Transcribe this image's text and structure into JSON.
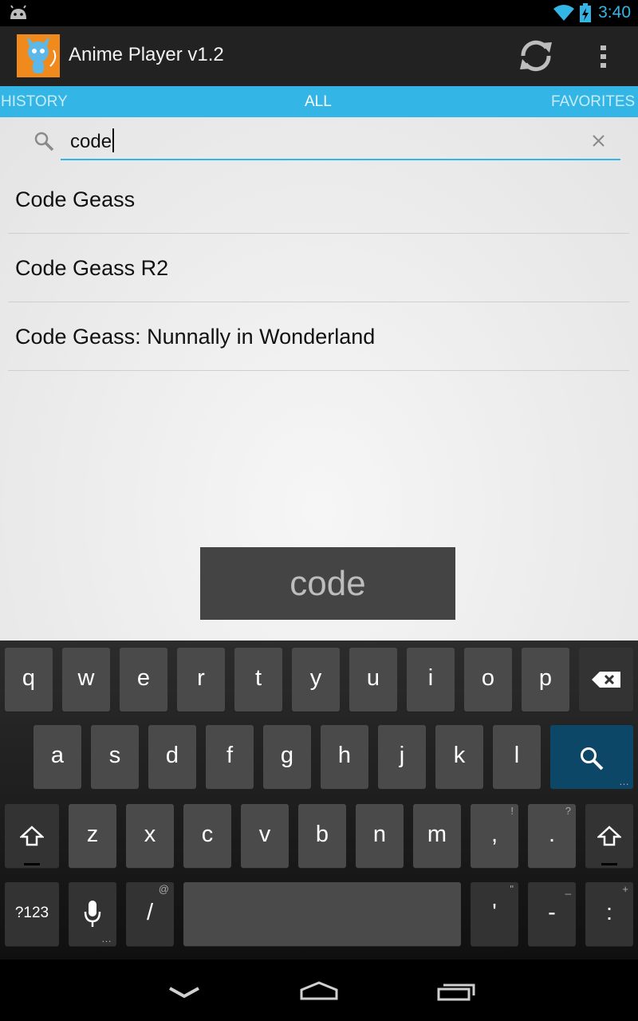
{
  "status_bar": {
    "time": "3:40",
    "icons": [
      "android-notification-icon",
      "wifi-icon",
      "battery-charging-icon"
    ]
  },
  "action_bar": {
    "title": "Anime Player v1.2",
    "app_icon": "anime-app-icon",
    "refresh_icon": "refresh-icon",
    "overflow_icon": "overflow-menu-icon"
  },
  "tabs": [
    {
      "label": "HISTORY",
      "active": false
    },
    {
      "label": "ALL",
      "active": true
    },
    {
      "label": "FAVORITES",
      "active": false
    }
  ],
  "search": {
    "value": "code",
    "search_icon": "search-icon",
    "clear_icon": "clear-icon"
  },
  "results": [
    {
      "title": "Code Geass"
    },
    {
      "title": "Code Geass R2"
    },
    {
      "title": "Code Geass: Nunnally in Wonderland"
    }
  ],
  "toast": {
    "text": "code"
  },
  "keyboard": {
    "row1": [
      "q",
      "w",
      "e",
      "r",
      "t",
      "y",
      "u",
      "i",
      "o",
      "p"
    ],
    "row2": [
      "a",
      "s",
      "d",
      "f",
      "g",
      "h",
      "j",
      "k",
      "l"
    ],
    "row3": [
      "z",
      "x",
      "c",
      "v",
      "b",
      "n",
      "m",
      ",",
      "."
    ],
    "row3_hints": {
      "comma": "!",
      "period": "?"
    },
    "row4": {
      "symbols": "?123",
      "slash": "/",
      "slash_hint": "@",
      "apostrophe": "'",
      "apostrophe_hint": "\"",
      "dash": "-",
      "dash_hint": "_",
      "colon": ":",
      "colon_hint": "+"
    }
  },
  "nav_bar": {
    "icons": [
      "back-icon",
      "home-icon",
      "recent-apps-icon"
    ]
  },
  "colors": {
    "accent": "#33b5e5",
    "action_bar": "#222222",
    "keyboard_key": "#4a4a4a",
    "search_key": "#0d4768"
  }
}
